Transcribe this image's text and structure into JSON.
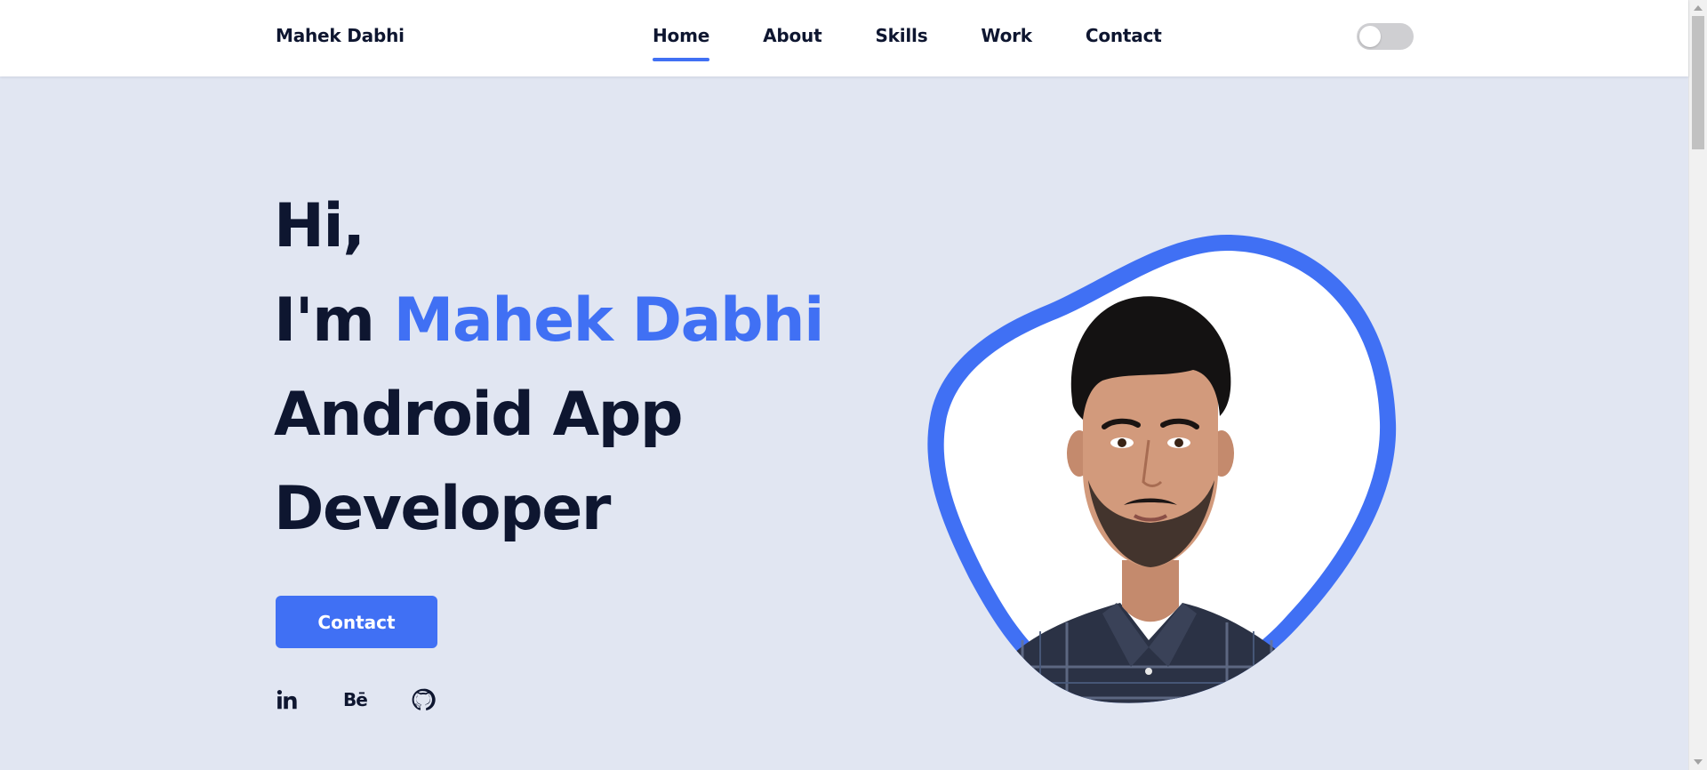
{
  "header": {
    "logo": "Mahek Dabhi",
    "nav": [
      {
        "label": "Home",
        "active": true
      },
      {
        "label": "About",
        "active": false
      },
      {
        "label": "Skills",
        "active": false
      },
      {
        "label": "Work",
        "active": false
      },
      {
        "label": "Contact",
        "active": false
      }
    ],
    "theme_toggle": {
      "state": "off"
    }
  },
  "hero": {
    "greeting": "Hi,",
    "intro": "I'm",
    "name": "Mahek Dabhi",
    "role_line_1": "Android App",
    "role_line_2": "Developer",
    "cta_label": "Contact",
    "social": [
      {
        "name": "linkedin",
        "icon": "linkedin-icon",
        "glyph": "in"
      },
      {
        "name": "behance",
        "icon": "behance-icon",
        "glyph": "Bē"
      },
      {
        "name": "github",
        "icon": "github-icon",
        "glyph": ""
      }
    ]
  },
  "avatar": {
    "subject": "profile-photo"
  },
  "colors": {
    "accent": "#4070f4",
    "text_dark": "#0e1630",
    "page_bg": "#e1e6f2",
    "header_bg": "#ffffff",
    "toggle_track": "#cfcfd2"
  }
}
